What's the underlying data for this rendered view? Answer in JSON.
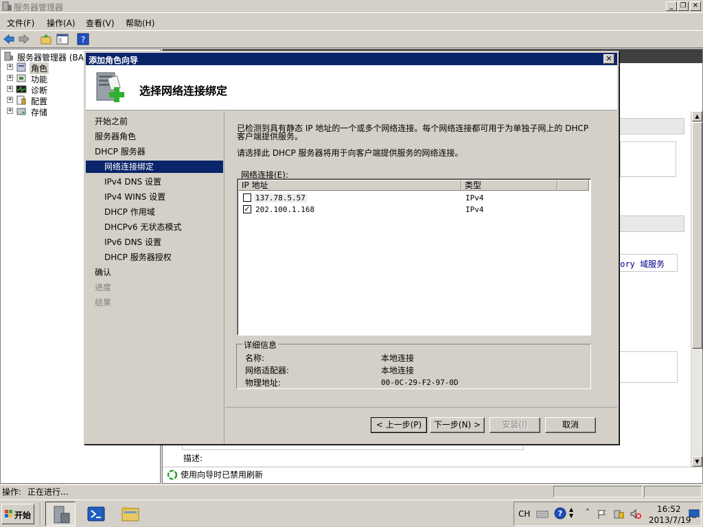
{
  "window": {
    "title": "服务器管理器",
    "menu": [
      "文件(F)",
      "操作(A)",
      "查看(V)",
      "帮助(H)"
    ]
  },
  "tree": {
    "root": "服务器管理器 (BA",
    "items": [
      "角色",
      "功能",
      "诊断",
      "配置",
      "存储"
    ]
  },
  "right_panel": {
    "visible_link": "tory 域服务",
    "description_label": "描述:",
    "refresh_notice": "使用向导时已禁用刷新"
  },
  "status": {
    "label": "操作:",
    "text": "正在进行..."
  },
  "dialog": {
    "title": "添加角色向导",
    "heading": "选择网络连接绑定",
    "nav": [
      {
        "label": "开始之前",
        "state": "normal",
        "level": "top"
      },
      {
        "label": "服务器角色",
        "state": "normal",
        "level": "top"
      },
      {
        "label": "DHCP 服务器",
        "state": "normal",
        "level": "top"
      },
      {
        "label": "网络连接绑定",
        "state": "active",
        "level": "sub"
      },
      {
        "label": "IPv4 DNS 设置",
        "state": "normal",
        "level": "sub"
      },
      {
        "label": "IPv4 WINS 设置",
        "state": "normal",
        "level": "sub"
      },
      {
        "label": "DHCP 作用域",
        "state": "normal",
        "level": "sub"
      },
      {
        "label": "DHCPv6 无状态模式",
        "state": "normal",
        "level": "sub"
      },
      {
        "label": "IPv6 DNS 设置",
        "state": "normal",
        "level": "sub"
      },
      {
        "label": "DHCP 服务器授权",
        "state": "normal",
        "level": "sub"
      },
      {
        "label": "确认",
        "state": "normal",
        "level": "top"
      },
      {
        "label": "进度",
        "state": "disabled",
        "level": "top"
      },
      {
        "label": "结果",
        "state": "disabled",
        "level": "top"
      }
    ],
    "intro_line1": "已检测到具有静态 IP 地址的一个或多个网络连接。每个网络连接都可用于为单独子网上的 DHCP",
    "intro_line2": "客户端提供服务。",
    "instruction": "请选择此 DHCP 服务器将用于向客户端提供服务的网络连接。",
    "list_label": "网络连接(E):",
    "columns": [
      "IP 地址",
      "类型"
    ],
    "connections": [
      {
        "ip": "137.78.5.57",
        "type": "IPv4",
        "checked": false
      },
      {
        "ip": "202.100.1.168",
        "type": "IPv4",
        "checked": true
      }
    ],
    "details": {
      "legend": "详细信息",
      "rows": [
        {
          "label": "名称:",
          "value": "本地连接"
        },
        {
          "label": "网络适配器:",
          "value": "本地连接"
        },
        {
          "label": "物理地址:",
          "value": "00-0C-29-F2-97-0D"
        }
      ]
    },
    "buttons": {
      "back": "< 上一步(P)",
      "next": "下一步(N) >",
      "install": "安装(I)",
      "cancel": "取消"
    }
  },
  "taskbar": {
    "start": "开始",
    "lang": "CH",
    "time": "16:52",
    "date": "2013/7/19"
  }
}
